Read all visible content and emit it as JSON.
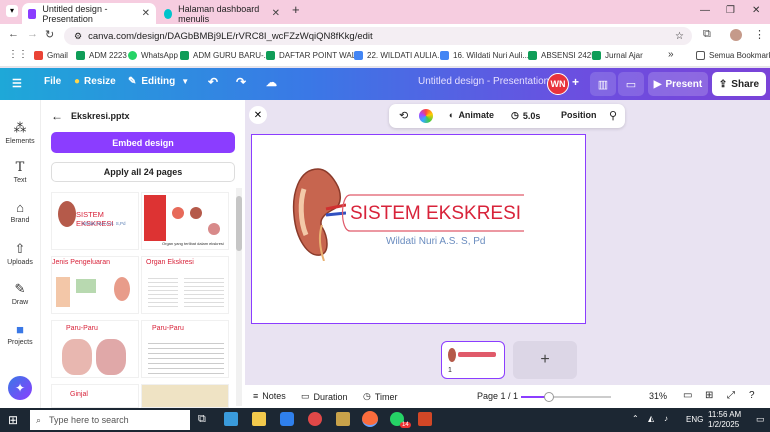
{
  "browser": {
    "tabs": [
      {
        "title": "Untitled design - Presentation",
        "active": true,
        "color": "#8b3dff"
      },
      {
        "title": "Halaman dashboard menulis",
        "active": false,
        "color": "#00c4cc"
      }
    ],
    "url": "canva.com/design/DAGbBMBj9LE/rVRC8I_wcFZzWqiQN8fKkg/edit",
    "bookmarks": [
      "Gmail",
      "ADM 2223",
      "WhatsApp",
      "ADM GURU BARU-...",
      "DAFTAR POINT WAL...",
      "22. WILDATI AULIA...",
      "16. Wildati Nuri Auli...",
      "ABSENSI 2425",
      "Jurnal Ajar",
      "Semua Bookmark"
    ]
  },
  "header": {
    "file": "File",
    "resize": "Resize",
    "editing": "Editing",
    "doc_title": "Untitled design - Presentation",
    "avatar": "WN",
    "present": "Present",
    "share": "Share"
  },
  "rail": [
    {
      "label": "Elements",
      "icon": "elements-icon"
    },
    {
      "label": "Text",
      "icon": "text-icon"
    },
    {
      "label": "Brand",
      "icon": "brand-icon"
    },
    {
      "label": "Uploads",
      "icon": "upload-icon"
    },
    {
      "label": "Draw",
      "icon": "draw-icon"
    },
    {
      "label": "Projects",
      "icon": "projects-icon"
    }
  ],
  "panel": {
    "title": "Ekskresi.pptx",
    "embed": "Embed design",
    "apply": "Apply all 24 pages",
    "thumbs": [
      {
        "title": "SISTEM EKSKRESI",
        "sub": "Wildati Nuri A.S. S,Pd"
      },
      {
        "title": "",
        "sub": "Organ yang terlibat dalam ekskresi"
      },
      {
        "title": "Jenis Pengeluaran",
        "sub": ""
      },
      {
        "title": "Organ Ekskresi",
        "sub": ""
      },
      {
        "title": "Paru-Paru",
        "sub": ""
      },
      {
        "title": "Paru-Paru",
        "sub": ""
      },
      {
        "title": "Ginjal",
        "sub": ""
      },
      {
        "title": "",
        "sub": ""
      }
    ]
  },
  "toolbar": {
    "animate": "Animate",
    "duration": "5.0s",
    "position": "Position"
  },
  "slide": {
    "title": "SISTEM EKSKRESI",
    "subtitle": "Wildati Nuri A.S. S, Pd"
  },
  "pages": {
    "current_num": "1"
  },
  "bottom": {
    "notes": "Notes",
    "duration": "Duration",
    "timer": "Timer",
    "page": "Page 1 / 1",
    "zoom": "31%",
    "zoom_level": 0.31
  },
  "taskbar": {
    "search": "Type here to search",
    "lang": "ENG",
    "time": "11:56 AM",
    "date": "1/2/2025",
    "badge": "14"
  }
}
